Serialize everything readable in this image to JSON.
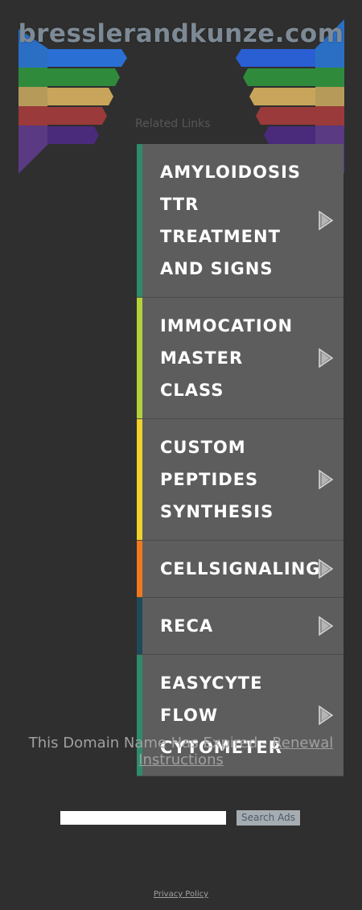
{
  "header": {
    "domain": "bresslerandkunze.com"
  },
  "related_label": "Related Links",
  "links": [
    {
      "label": "AMYLOIDOSIS\nTTR\nTREATMENT\nAND SIGNS",
      "color": "#2e8b6e"
    },
    {
      "label": "IMMOCATION\nMASTER CLASS",
      "color": "#b5d13a"
    },
    {
      "label": "CUSTOM\nPEPTIDES\nSYNTHESIS",
      "color": "#f0d22a"
    },
    {
      "label": "CELLSIGNALING",
      "color": "#f0781e"
    },
    {
      "label": "RECA",
      "color": "#1e4b5a"
    },
    {
      "label": "EASYCYTE\nFLOW\nCYTOMETER",
      "color": "#2e8b6e"
    }
  ],
  "footer": {
    "expired_text": "This Domain Name Has Expired - ",
    "renewal_link": "Renewal Instructions",
    "search_button": "Search Ads",
    "privacy": "Privacy Policy"
  },
  "icons": {
    "arrow": "play-arrow-icon"
  }
}
